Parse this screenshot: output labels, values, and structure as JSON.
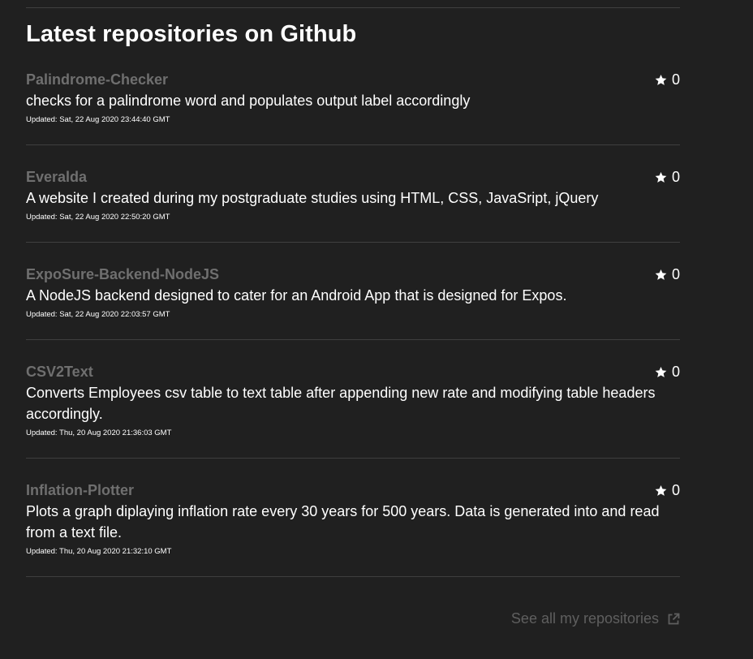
{
  "section": {
    "title": "Latest repositories on Github"
  },
  "repos": [
    {
      "name": "Palindrome-Checker",
      "description": "checks for a palindrome word and populates output label accordingly",
      "updated": "Updated: Sat, 22 Aug 2020 23:44:40 GMT",
      "stars": "0"
    },
    {
      "name": "Everalda",
      "description": "A website I created during my postgraduate studies using HTML, CSS, JavaSript, jQuery",
      "updated": "Updated: Sat, 22 Aug 2020 22:50:20 GMT",
      "stars": "0"
    },
    {
      "name": "ExpoSure-Backend-NodeJS",
      "description": "A NodeJS backend designed to cater for an Android App that is designed for Expos.",
      "updated": "Updated: Sat, 22 Aug 2020 22:03:57 GMT",
      "stars": "0"
    },
    {
      "name": "CSV2Text",
      "description": "Converts Employees csv table to text table after appending new rate and modifying table headers accordingly.",
      "updated": "Updated: Thu, 20 Aug 2020 21:36:03 GMT",
      "stars": "0"
    },
    {
      "name": "Inflation-Plotter",
      "description": "Plots a graph diplaying inflation rate every 30 years for 500 years. Data is generated into and read from a text file.",
      "updated": "Updated: Thu, 20 Aug 2020 21:32:10 GMT",
      "stars": "0"
    }
  ],
  "footer": {
    "see_all_label": "See all my repositories"
  },
  "icons": {
    "star": "star-icon",
    "external": "external-link-icon"
  },
  "colors": {
    "background": "#202020",
    "repo_name": "#6f6f6f",
    "link_muted": "#5f5f5f",
    "divider": "#3f3f3f"
  }
}
